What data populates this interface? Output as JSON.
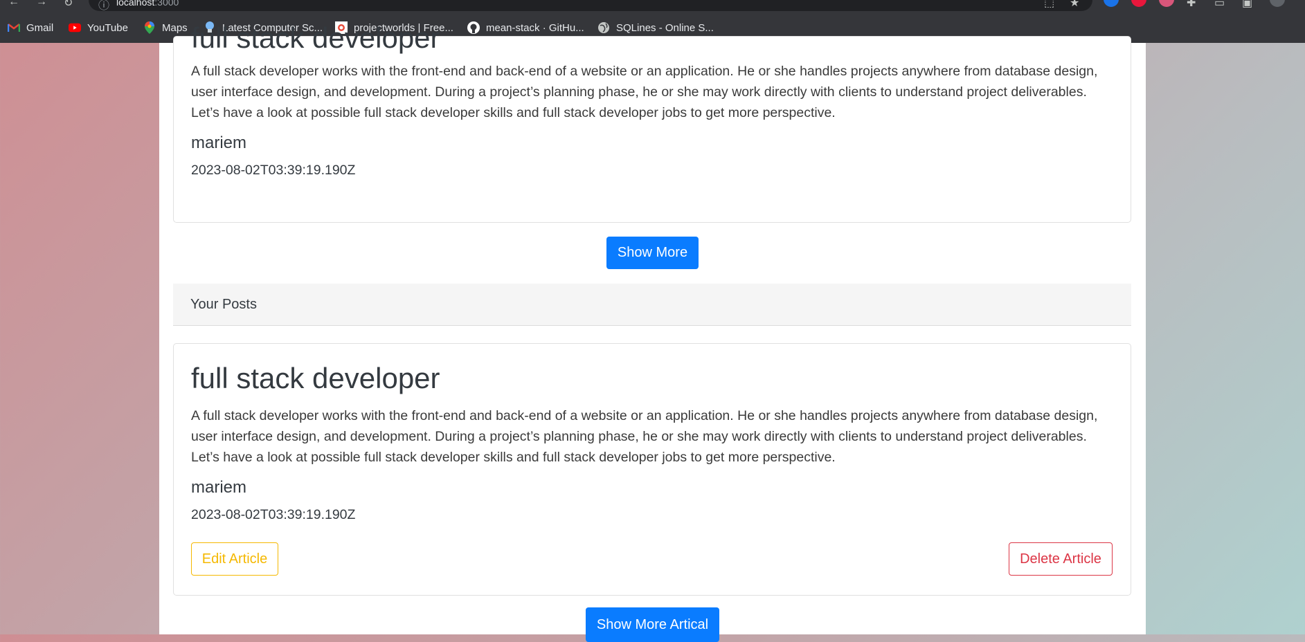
{
  "browser": {
    "address": {
      "host": "localhost",
      "port": ":3000"
    },
    "bookmarks": [
      {
        "label": "Gmail",
        "icon": "gmail-icon"
      },
      {
        "label": "YouTube",
        "icon": "youtube-icon"
      },
      {
        "label": "Maps",
        "icon": "maps-icon"
      },
      {
        "label": "Latest Computer Sc...",
        "icon": "lightbulb-icon"
      },
      {
        "label": "projectworlds | Free...",
        "icon": "projectworlds-icon"
      },
      {
        "label": "mean-stack · GitHu...",
        "icon": "github-icon"
      },
      {
        "label": "SQLines - Online S...",
        "icon": "globe-icon"
      }
    ]
  },
  "top_article": {
    "title": "full stack developer",
    "body": "A full stack developer works with the front-end and back-end of a website or an application. He or she handles projects anywhere from database design, user interface design, and development. During a project’s planning phase, he or she may work directly with clients to understand project deliverables. Let’s have a look at possible full stack developer skills and full stack developer jobs to get more perspective.",
    "author": "mariem",
    "date": "2023-08-02T03:39:19.190Z"
  },
  "show_more_label": "Show More",
  "your_posts": {
    "header": "Your Posts",
    "article": {
      "title": "full stack developer",
      "body": "A full stack developer works with the front-end and back-end of a website or an application. He or she handles projects anywhere from database design, user interface design, and development. During a project’s planning phase, he or she may work directly with clients to understand project deliverables. Let’s have a look at possible full stack developer skills and full stack developer jobs to get more perspective.",
      "author": "mariem",
      "date": "2023-08-02T03:39:19.190Z",
      "edit_label": "Edit Article",
      "delete_label": "Delete Article"
    },
    "show_more_label": "Show More Artical"
  },
  "colors": {
    "primary": "#0a7cff",
    "warning": "#f5b800",
    "danger": "#dc3545"
  }
}
